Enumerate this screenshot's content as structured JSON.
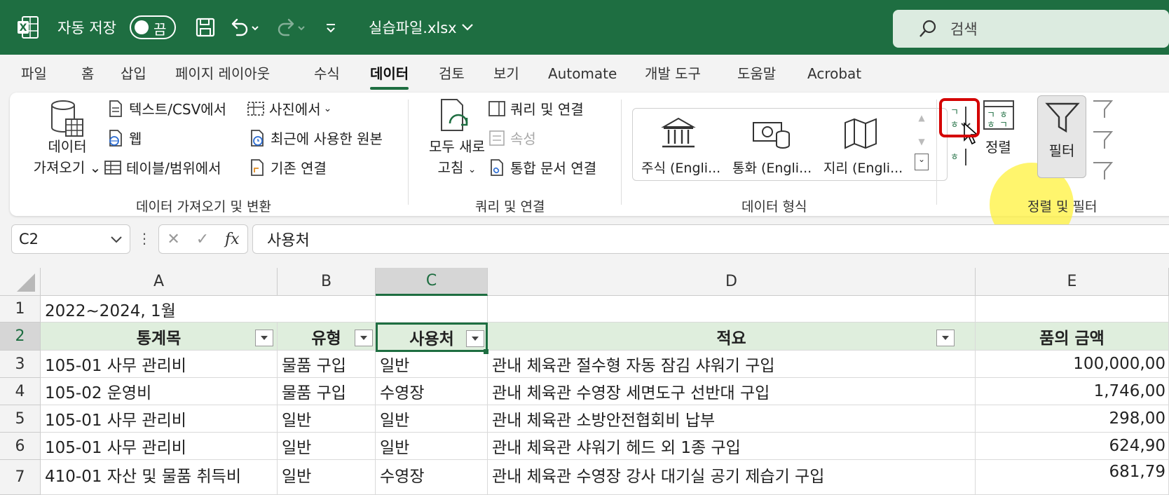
{
  "titlebar": {
    "autosave_label": "자동 저장",
    "autosave_state": "끔",
    "filename": "실습파일.xlsx",
    "search_placeholder": "검색",
    "accent": "#1e6e41"
  },
  "tabs": [
    {
      "label": "파일"
    },
    {
      "label": "홈"
    },
    {
      "label": "삽입"
    },
    {
      "label": "페이지 레이아웃"
    },
    {
      "label": "수식"
    },
    {
      "label": "데이터",
      "active": true
    },
    {
      "label": "검토"
    },
    {
      "label": "보기"
    },
    {
      "label": "Automate"
    },
    {
      "label": "개발 도구"
    },
    {
      "label": "도움말"
    },
    {
      "label": "Acrobat"
    }
  ],
  "ribbon": {
    "get_data": {
      "line1": "데이터",
      "line2": "가져오기",
      "chev": "⌄"
    },
    "from_text_csv": "텍스트/CSV에서",
    "web": "웹",
    "from_table": "테이블/범위에서",
    "from_picture": "사진에서",
    "recent_sources": "최근에 사용한 원본",
    "existing_connections": "기존 연결",
    "group_get_transform": "데이터 가져오기 및 변환",
    "refresh_all": {
      "line1": "모두 새로",
      "line2": "고침"
    },
    "queries_connections": "쿼리 및 연결",
    "properties": "속성",
    "edit_links": "통합 문서 연결",
    "group_queries": "쿼리 및 연결",
    "data_types": [
      "주식 (Engli...",
      "통화 (Engli...",
      "지리 (Engli..."
    ],
    "group_data_types": "데이터 형식",
    "sort": "정렬",
    "filter": "필터",
    "group_sort_filter": "정렬 및 필터"
  },
  "formula": {
    "name_box": "C2",
    "fx": "fx",
    "content": "사용처"
  },
  "sheet": {
    "columns": [
      "A",
      "B",
      "C",
      "D",
      "E"
    ],
    "rows": [
      "1",
      "2",
      "3",
      "4",
      "5",
      "6",
      "7"
    ],
    "r1": {
      "a": "2022~2024, 1월"
    },
    "headers": {
      "a": "통계목",
      "b": "유형",
      "c": "사용처",
      "d": "적요",
      "e": "품의 금액"
    },
    "data": [
      {
        "a": "105-01 사무 관리비",
        "b": "물품 구입",
        "c": "일반",
        "d": "관내 체육관 절수형 자동 잠김 샤워기 구입",
        "e": "100,000,00"
      },
      {
        "a": "105-02 운영비",
        "b": "물품 구입",
        "c": "수영장",
        "d": "관내 체육관 수영장 세면도구 선반대 구입",
        "e": "1,746,00"
      },
      {
        "a": "105-01 사무 관리비",
        "b": "일반",
        "c": "일반",
        "d": "관내 체육관 소방안전협회비 납부",
        "e": "298,00"
      },
      {
        "a": "105-01 사무 관리비",
        "b": "일반",
        "c": "일반",
        "d": "관내 체육관 샤워기 헤드 외 1종 구입",
        "e": "624,90"
      },
      {
        "a": "410-01 자산 및 물품 취득비",
        "b": "일반",
        "c": "수영장",
        "d": "관내 체육관 수영장 강사 대기실 공기 제습기 구입",
        "e": "681,79"
      }
    ]
  }
}
